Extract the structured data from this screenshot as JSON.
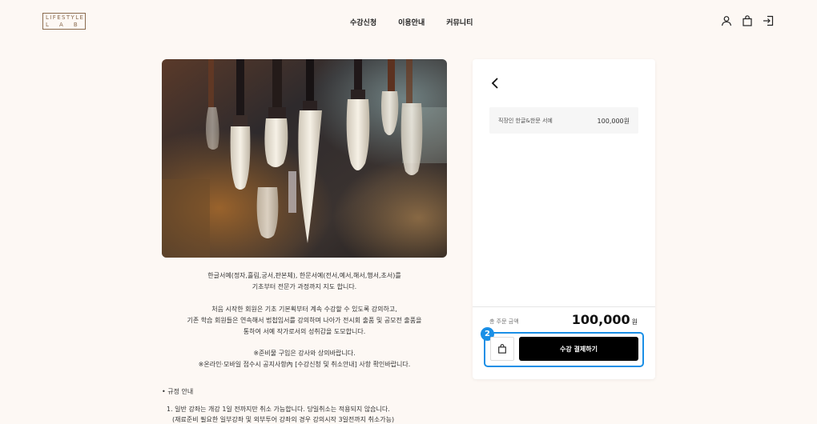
{
  "header": {
    "logo_top": "LIFESTYLE",
    "logo_bottom": "LAB",
    "nav": [
      "수강신청",
      "이용안내",
      "커뮤니티"
    ],
    "icons": [
      "user-icon",
      "bag-icon",
      "login-icon"
    ]
  },
  "hero": {
    "subject": "calligraphy brushes"
  },
  "description": {
    "para1": [
      "한글서예(정자,흘림,궁서,판본체), 한문서예(전서,예서,해서,행서,초서)를",
      "기초부터 전문가 과정까지 지도 합니다."
    ],
    "para2": [
      "처음 시작한 회원은 기초 기본획부터 계속 수강할 수 있도록 강의하고,",
      "기존 학습 회원들은 연속해서 법첩임서를 강의하며 나아가 전시회 출품 및 공모전 출품을",
      "통하여 서예 작가로서의 성취감을 도모합니다."
    ],
    "para3": [
      "※준비물 구입은 강사와 상의바랍니다.",
      "※온라인·모바일 접수시 공지사항內 [수강신청 및 취소안내] 사항 확인바랍니다."
    ]
  },
  "rules": {
    "title": "• 규정 안내",
    "lines": [
      "1. 일반 강좌는 개강 1일 전까지만 취소 가능합니다. 당일취소는 적용되지 않습니다.",
      "(재료준비 필요한 일부강좌 및 외부투어 강좌의 경우 강의시작 3일전까지 취소가능)"
    ]
  },
  "panel": {
    "item_name": "직장인 한글&한문 서예",
    "item_price": "100,000원",
    "total_label": "총 주문 금액",
    "total_amount": "100,000",
    "total_unit": "원",
    "badge": "2",
    "pay_label": "수강 결제하기",
    "highlight_color": "#1a8fe6"
  }
}
